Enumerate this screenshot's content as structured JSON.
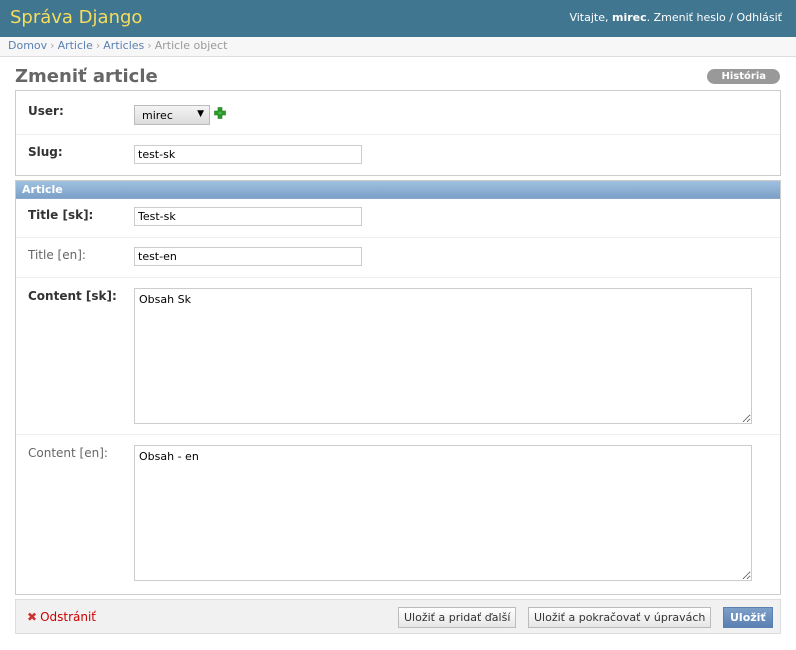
{
  "header": {
    "site_title": "Správa Django",
    "welcome": "Vitajte,",
    "username": "mirec",
    "change_password": "Zmeniť heslo",
    "separator": "/",
    "logout": "Odhlásiť"
  },
  "breadcrumbs": {
    "home": "Domov",
    "app": "Article",
    "model": "Articles",
    "current": "Article object",
    "sep": "›"
  },
  "page": {
    "title": "Zmeniť article",
    "history_button": "História"
  },
  "form": {
    "user": {
      "label": "User:",
      "selected": "mirec"
    },
    "slug": {
      "label": "Slug:",
      "value": "test-sk"
    },
    "article_section": "Article",
    "title_sk": {
      "label": "Title [sk]:",
      "value": "Test-sk"
    },
    "title_en": {
      "label": "Title [en]:",
      "value": "test-en"
    },
    "content_sk": {
      "label": "Content [sk]:",
      "value": "Obsah Sk"
    },
    "content_en": {
      "label": "Content [en]:",
      "value": "Obsah - en"
    }
  },
  "submit_row": {
    "delete": "Odstrániť",
    "save_add": "Uložiť a pridať ďalší",
    "save_continue": "Uložiť a pokračovať v úpravách",
    "save": "Uložiť"
  },
  "colors": {
    "header_bg": "#417690",
    "site_title": "#f5dd5d",
    "link": "#5b80b2",
    "delete": "#cc0000"
  },
  "icons": {
    "add_related": "plus-icon",
    "delete": "close-icon"
  }
}
